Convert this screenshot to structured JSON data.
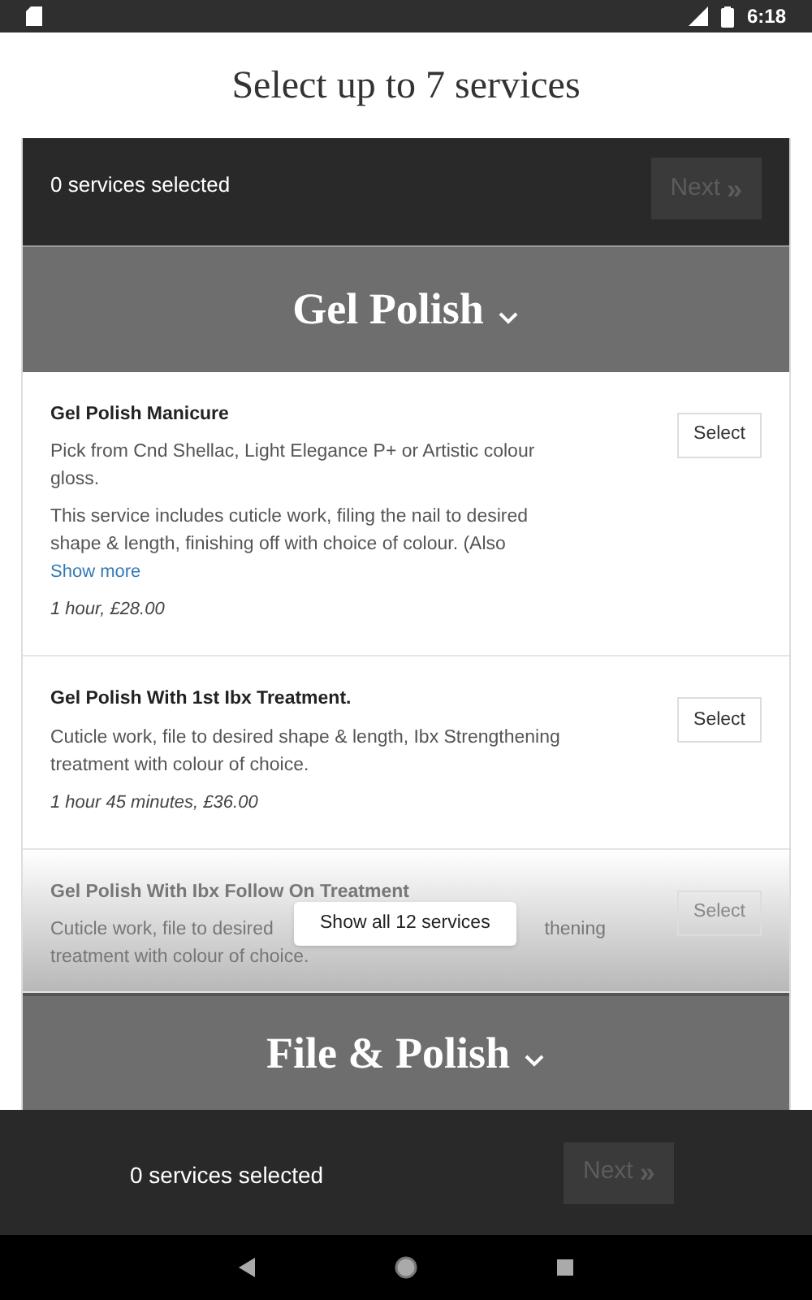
{
  "status_bar": {
    "time": "6:18"
  },
  "title": "Select up to 7 services",
  "top_bar": {
    "count": "0 services selected",
    "next": {
      "label": "Next",
      "icon": "»",
      "disabled": true
    }
  },
  "categories": [
    {
      "name": "Gel Polish",
      "expanded": true,
      "services": [
        {
          "title": "Gel Polish Manicure",
          "paragraphs": [
            "Pick from Cnd Shellac, Light Elegance P+ or Artistic colour gloss.",
            "This service includes cuticle work, filing the nail to desired shape & length, finishing off with choice of colour. (Also"
          ],
          "show_more": "Show more",
          "duration": "1 hour, £28.00",
          "button": "Select",
          "faded": false
        },
        {
          "title": "Gel Polish With 1st Ibx Treatment.",
          "paragraphs": [
            "Cuticle work, file to desired shape & length, Ibx Strengthening treatment with colour of choice."
          ],
          "duration": "1 hour 45 minutes, £36.00",
          "button": "Select",
          "faded": false
        },
        {
          "title": "Gel Polish With Ibx Follow On Treatment",
          "visible_lines": [
            [
              "Cuticle work, file to desired",
              "thening"
            ],
            [
              "treatment with colour of choice."
            ]
          ],
          "button": "Select",
          "faded": true
        }
      ],
      "show_all": "Show all 12 services"
    },
    {
      "name": "File & Polish",
      "expanded": false
    }
  ],
  "bottom_bar": {
    "count": "0 services selected",
    "next": {
      "label": "Next",
      "icon": "»",
      "disabled": true
    }
  }
}
